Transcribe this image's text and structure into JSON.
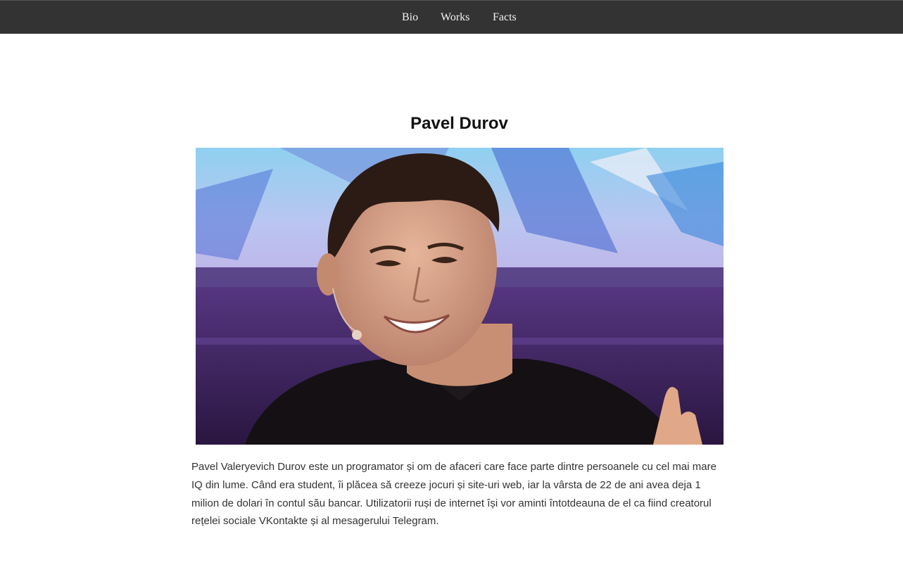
{
  "nav": {
    "items": [
      {
        "label": "Bio"
      },
      {
        "label": "Works"
      },
      {
        "label": "Facts"
      }
    ]
  },
  "page": {
    "title": "Pavel Durov",
    "bio": "Pavel Valeryevich Durov este un programator și om de afaceri care face parte dintre persoanele cu cel mai mare IQ din lume. Când era student, îi plăcea să creeze jocuri și site-uri web, iar la vârsta de 22 de ani avea deja 1 milion de dolari în contul său bancar. Utilizatorii ruși de internet își vor aminti întotdeauna de el ca fiind creatorul rețelei sociale VKontakte și al mesagerului Telegram."
  },
  "colors": {
    "nav_background": "#333333",
    "nav_text": "#f2f2f2",
    "title_text": "#111111",
    "body_text": "#333333"
  }
}
